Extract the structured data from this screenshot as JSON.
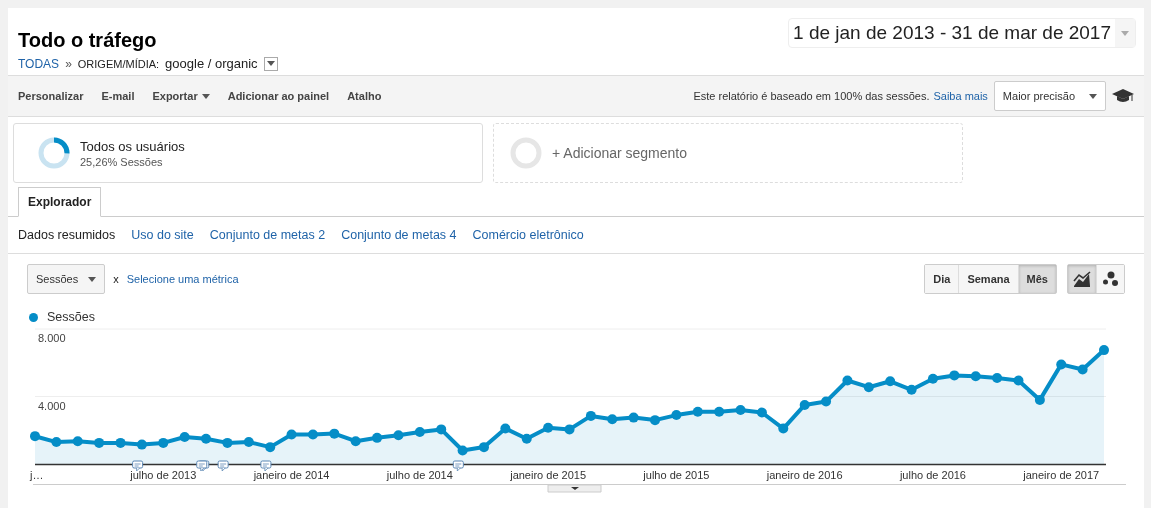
{
  "header": {
    "title": "Todo o tráfego",
    "breadcrumb": {
      "root": "TODAS",
      "separator": "»",
      "dimension": "ORIGEM/MÍDIA:",
      "value": "google / organic"
    },
    "date_range": "1 de jan de 2013 - 31 de mar de 2017"
  },
  "toolbar": {
    "actions": [
      {
        "label": "Personalizar",
        "dropdown": false
      },
      {
        "label": "E-mail",
        "dropdown": false
      },
      {
        "label": "Exportar",
        "dropdown": true
      },
      {
        "label": "Adicionar ao painel",
        "dropdown": false
      },
      {
        "label": "Atalho",
        "dropdown": false
      }
    ],
    "sampling_note": "Este relatório é baseado em 100% das sessões.",
    "learn_more": "Saiba mais",
    "precision": "Maior precisão"
  },
  "segments": [
    {
      "kind": "segment",
      "name": "Todos os usuários",
      "detail": "25,26% Sessões",
      "level": 0.2526
    },
    {
      "kind": "add",
      "name": "+ Adicionar segmento"
    }
  ],
  "tabs": [
    {
      "label": "Explorador",
      "selected": true
    }
  ],
  "subnav": [
    {
      "label": "Dados resumidos",
      "selected": true
    },
    {
      "label": "Uso do site",
      "selected": false
    },
    {
      "label": "Conjunto de metas 2",
      "selected": false
    },
    {
      "label": "Conjunto de metas 4",
      "selected": false
    },
    {
      "label": "Comércio eletrônico",
      "selected": false
    }
  ],
  "metric": {
    "selector": "Sessões",
    "remove": "x",
    "add": "Selecione uma métrica"
  },
  "granularity": [
    {
      "label": "Dia",
      "selected": false
    },
    {
      "label": "Semana",
      "selected": false
    },
    {
      "label": "Mês",
      "selected": true
    }
  ],
  "chart_types": [
    {
      "kind": "line",
      "selected": true
    },
    {
      "kind": "motion",
      "selected": false
    }
  ],
  "chart": {
    "chart_data": {
      "type": "area",
      "categories": [
        "j…",
        null,
        null,
        null,
        null,
        null,
        "julho de 2013",
        null,
        null,
        null,
        null,
        null,
        "janeiro de 2014",
        null,
        null,
        null,
        null,
        null,
        "julho de 2014",
        null,
        null,
        null,
        null,
        null,
        "janeiro de 2015",
        null,
        null,
        null,
        null,
        null,
        "julho de 2015",
        null,
        null,
        null,
        null,
        null,
        "janeiro de 2016",
        null,
        null,
        null,
        null,
        null,
        "julho de 2016",
        null,
        null,
        null,
        null,
        null,
        "janeiro de 2017",
        null,
        null
      ],
      "series": [
        {
          "name": "Sessões",
          "color": "#058dc7",
          "values": [
            1650,
            1300,
            1350,
            1250,
            1250,
            1150,
            1250,
            1600,
            1500,
            1250,
            1300,
            1000,
            1750,
            1750,
            1800,
            1350,
            1550,
            1700,
            1900,
            2050,
            800,
            1000,
            2100,
            1500,
            2150,
            2050,
            2850,
            2650,
            2750,
            2600,
            2900,
            3100,
            3100,
            3200,
            3050,
            2100,
            3500,
            3700,
            4950,
            4550,
            4900,
            4400,
            5050,
            5250,
            5200,
            5100,
            4950,
            3800,
            5900,
            5600,
            6750
          ]
        }
      ],
      "ylim": [
        0,
        8000
      ],
      "yticks": [
        {
          "value": 4000,
          "label": "4.000"
        },
        {
          "value": 8000,
          "label": "8.000"
        }
      ]
    },
    "note_markers": [
      {
        "kind": "none"
      },
      {
        "kind": "none"
      },
      {
        "kind": "none"
      },
      {
        "kind": "none"
      },
      {
        "kind": "none"
      },
      {
        "kind": "single"
      },
      {
        "kind": "none"
      },
      {
        "kind": "none"
      },
      {
        "kind": "multiple"
      },
      {
        "kind": "single"
      },
      {
        "kind": "none"
      },
      {
        "kind": "single"
      },
      {
        "kind": "none"
      },
      {
        "kind": "none"
      },
      {
        "kind": "none"
      },
      {
        "kind": "none"
      },
      {
        "kind": "none"
      },
      {
        "kind": "none"
      },
      {
        "kind": "none"
      },
      {
        "kind": "none"
      },
      {
        "kind": "single"
      },
      {
        "kind": "none"
      },
      {
        "kind": "none"
      },
      {
        "kind": "none"
      },
      {
        "kind": "none"
      },
      {
        "kind": "none"
      },
      {
        "kind": "none"
      },
      {
        "kind": "none"
      },
      {
        "kind": "none"
      },
      {
        "kind": "none"
      },
      {
        "kind": "none"
      },
      {
        "kind": "none"
      },
      {
        "kind": "none"
      },
      {
        "kind": "none"
      },
      {
        "kind": "none"
      },
      {
        "kind": "none"
      },
      {
        "kind": "none"
      },
      {
        "kind": "none"
      },
      {
        "kind": "none"
      },
      {
        "kind": "none"
      },
      {
        "kind": "none"
      },
      {
        "kind": "none"
      },
      {
        "kind": "none"
      },
      {
        "kind": "none"
      },
      {
        "kind": "none"
      },
      {
        "kind": "none"
      },
      {
        "kind": "none"
      },
      {
        "kind": "none"
      },
      {
        "kind": "none"
      },
      {
        "kind": "none"
      },
      {
        "kind": "none"
      }
    ]
  }
}
